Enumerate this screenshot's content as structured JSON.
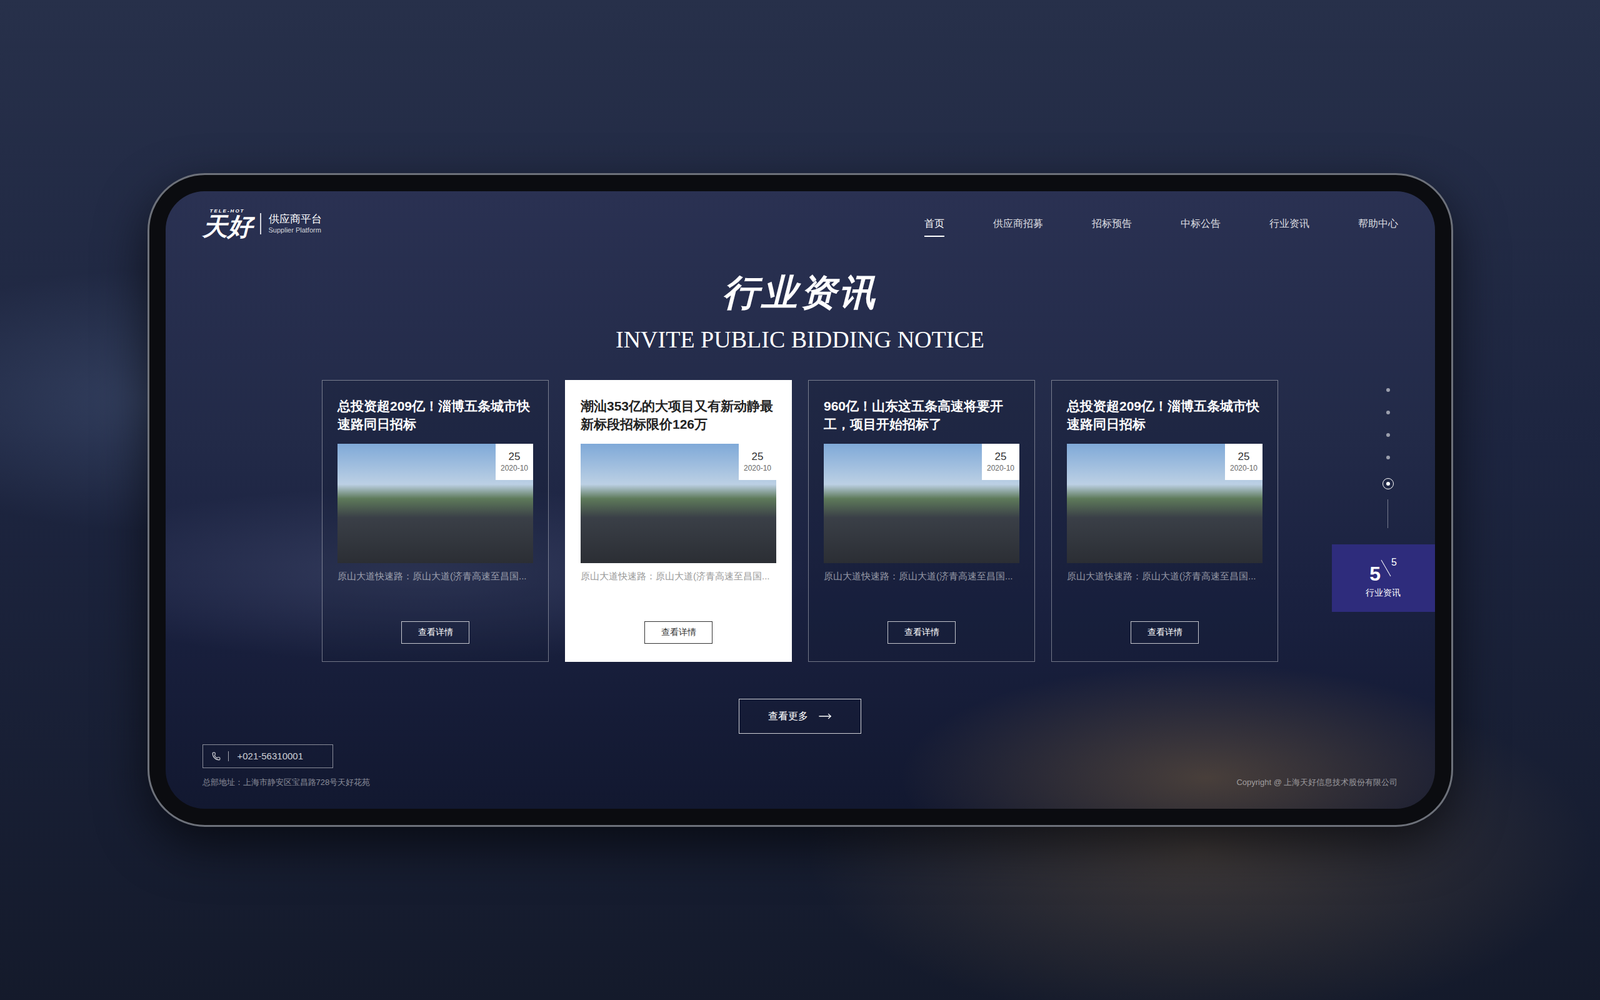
{
  "logo": {
    "tag": "TELE-HOT",
    "mark": "天好",
    "name": "供应商平台",
    "subtitle": "Supplier Platform"
  },
  "nav": [
    {
      "label": "首页",
      "selected": true
    },
    {
      "label": "供应商招募",
      "selected": false
    },
    {
      "label": "招标预告",
      "selected": false
    },
    {
      "label": "中标公告",
      "selected": false
    },
    {
      "label": "行业资讯",
      "selected": false
    },
    {
      "label": "帮助中心",
      "selected": false
    }
  ],
  "section": {
    "title": "行业资讯",
    "subtitle": "INVITE PUBLIC BIDDING NOTICE"
  },
  "cards": [
    {
      "title": "总投资超209亿！淄博五条城市快速路同日招标",
      "day": "25",
      "month": "2020-10",
      "excerpt": "原山大道快速路：原山大道(济青高速至昌国...",
      "button": "查看详情",
      "selected": false
    },
    {
      "title": "潮汕353亿的大项目又有新动静最新标段招标限价126万",
      "day": "25",
      "month": "2020-10",
      "excerpt": "原山大道快速路：原山大道(济青高速至昌国...",
      "button": "查看详情",
      "selected": true
    },
    {
      "title": "960亿！山东这五条高速将要开工，项目开始招标了",
      "day": "25",
      "month": "2020-10",
      "excerpt": "原山大道快速路：原山大道(济青高速至昌国...",
      "button": "查看详情",
      "selected": false
    },
    {
      "title": "总投资超209亿！淄博五条城市快速路同日招标",
      "day": "25",
      "month": "2020-10",
      "excerpt": "原山大道快速路：原山大道(济青高速至昌国...",
      "button": "查看详情",
      "selected": false
    }
  ],
  "more_button": "查看更多",
  "pager": {
    "dots": [
      {
        "selected": false
      },
      {
        "selected": false
      },
      {
        "selected": false
      },
      {
        "selected": false
      },
      {
        "selected": true
      }
    ],
    "current": "5",
    "total": "5",
    "label": "行业资讯"
  },
  "footer": {
    "phone": "+021-56310001",
    "address": "总部地址：上海市静安区宝昌路728号天好花苑",
    "copyright": "Copyright  @  上海天好信息技术股份有限公司"
  }
}
